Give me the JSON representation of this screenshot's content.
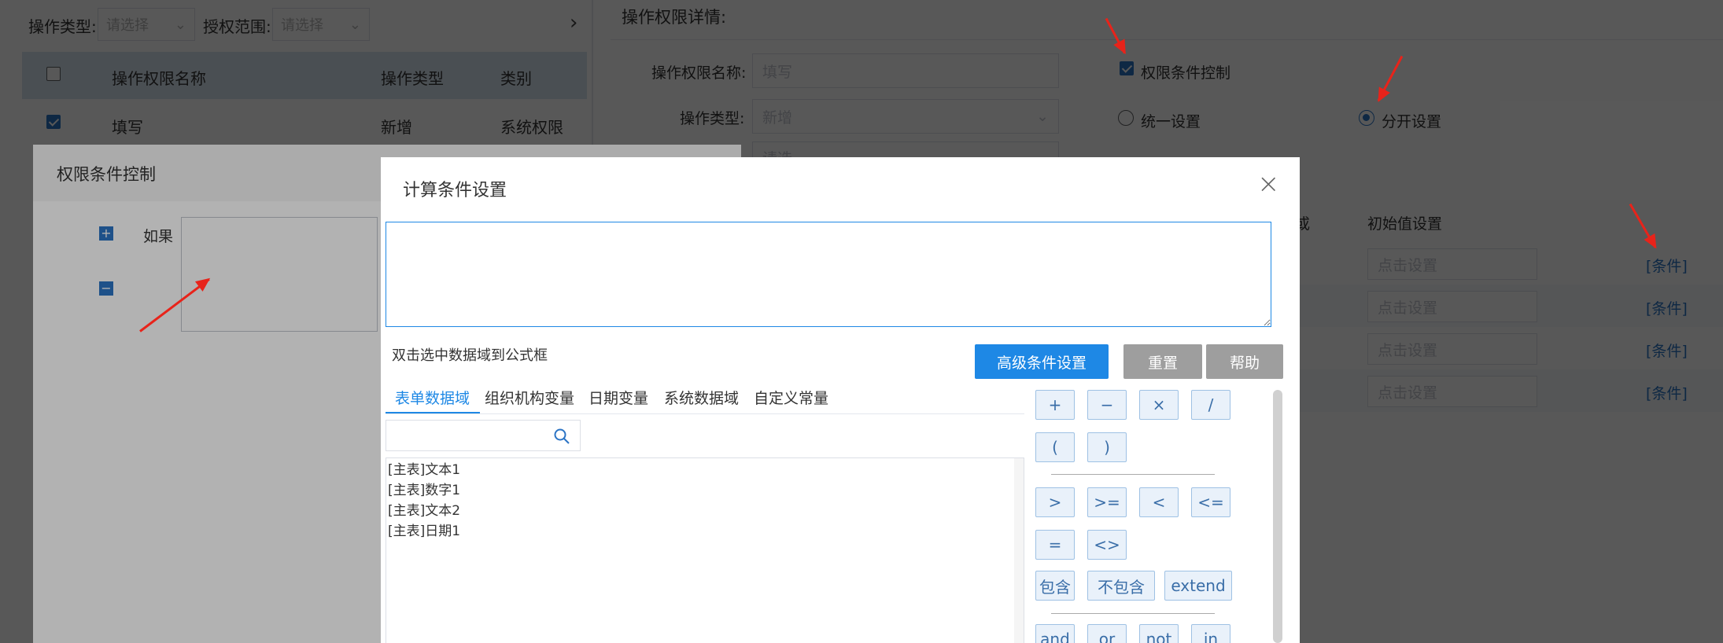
{
  "filter": {
    "op_type_label": "操作类型:",
    "op_type_placeholder": "请选择",
    "scope_label": "授权范围:",
    "scope_placeholder": "请选择",
    "next_icon": "chevron-right-icon"
  },
  "left_table": {
    "columns": [
      "操作权限名称",
      "操作类型",
      "类别"
    ],
    "rows": [
      {
        "name": "填写",
        "type": "新增",
        "category": "系统权限",
        "checked": true
      }
    ]
  },
  "detail": {
    "title": "操作权限详情:",
    "name_label": "操作权限名称:",
    "name_value": "填写",
    "type_label": "操作类型:",
    "type_value": "新增",
    "hidden_value": "请选",
    "permission_condition_label": "权限条件控制",
    "permission_condition_checked": true,
    "radio_unified": "统一设置",
    "radio_separate": "分开设置",
    "radio_selected": "分开设置",
    "col_fragment": "或",
    "init_header": "初始值设置",
    "rows": [
      {
        "init_placeholder": "点击设置",
        "link": "[条件]"
      },
      {
        "init_placeholder": "点击设置",
        "link": "[条件]"
      },
      {
        "init_placeholder": "点击设置",
        "link": "[条件]"
      },
      {
        "init_placeholder": "点击设置",
        "link": "[条件]"
      }
    ]
  },
  "perm_dialog": {
    "title": "权限条件控制",
    "if_label": "如果"
  },
  "calc_dialog": {
    "title": "计算条件设置",
    "close_icon": "close-icon",
    "formula_value": "",
    "hint": "双击选中数据域到公式框",
    "advanced_button": "高级条件设置",
    "reset_button": "重置",
    "help_button": "帮助",
    "tabs": [
      "表单数据域",
      "组织机构变量",
      "日期变量",
      "系统数据域",
      "自定义常量"
    ],
    "active_tab": "表单数据域",
    "search_placeholder": "",
    "fields": [
      "[主表]文本1",
      "[主表]数字1",
      "[主表]文本2",
      "[主表]日期1"
    ],
    "operators_row1": [
      "+",
      "−",
      "×",
      "/"
    ],
    "operators_row2": [
      "(",
      ")"
    ],
    "operators_row3": [
      ">",
      ">=",
      "<",
      "<="
    ],
    "operators_row4": [
      "=",
      "<>"
    ],
    "operators_row5": [
      "包含",
      "不包含",
      "extend"
    ],
    "operators_row6": [
      "and",
      "or",
      "not",
      "in"
    ]
  },
  "colors": {
    "accent": "#2b74c5",
    "primary_button": "#1e88e5",
    "gray_button": "#9e9e9e",
    "arrow": "#e8231a"
  }
}
